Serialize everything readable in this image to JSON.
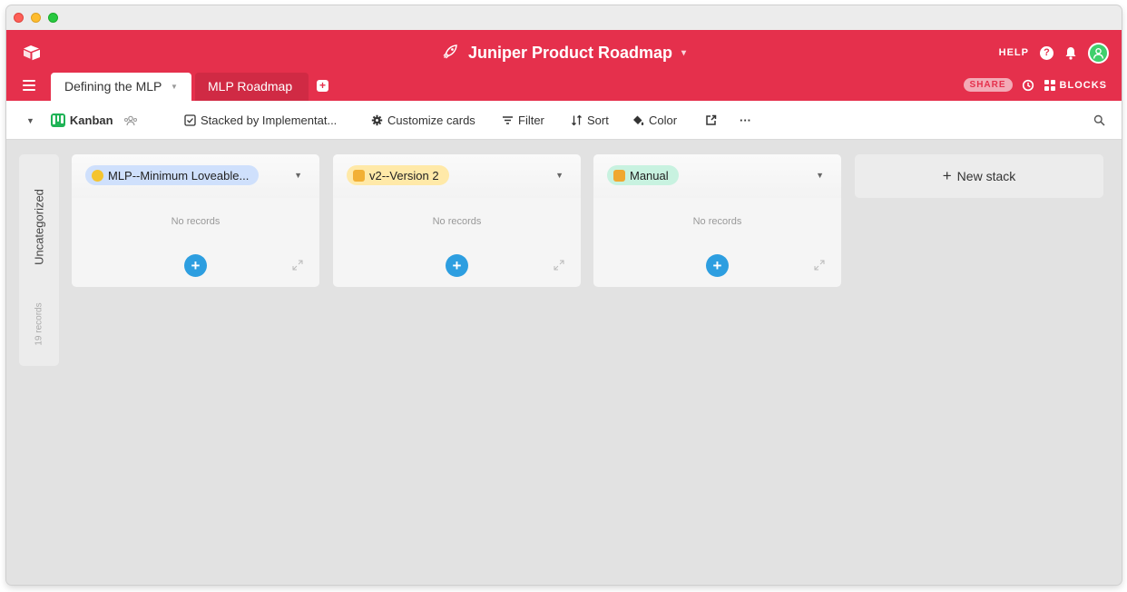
{
  "window": {
    "traffic_lights": [
      "close",
      "minimize",
      "zoom"
    ]
  },
  "header": {
    "base_title": "Juniper Product Roadmap",
    "help_label": "HELP",
    "help_icon": "?",
    "share_label": "SHARE",
    "blocks_label": "BLOCKS",
    "brand_color": "#e5304c"
  },
  "tabs": [
    {
      "label": "Defining the MLP",
      "active": true
    },
    {
      "label": "MLP Roadmap",
      "active": false
    }
  ],
  "add_tab_icon": "+",
  "viewbar": {
    "view_name": "Kanban",
    "stacked_by": "Stacked by Implementat...",
    "customize": "Customize cards",
    "filter": "Filter",
    "sort": "Sort",
    "color": "Color",
    "more": "···"
  },
  "board": {
    "uncategorized": {
      "title": "Uncategorized",
      "count": "19 records"
    },
    "stacks": [
      {
        "label": "MLP--Minimum Loveable...",
        "empty_text": "No records",
        "pill_color": "#cfe0fc",
        "icon": "yellow-heart-icon"
      },
      {
        "label": "v2--Version 2",
        "empty_text": "No records",
        "pill_color": "#ffe9a8",
        "icon": "victory-hand-icon"
      },
      {
        "label": "Manual",
        "empty_text": "No records",
        "pill_color": "#c8f2e0",
        "icon": "flexed-biceps-icon"
      }
    ],
    "new_stack_label": "New stack",
    "add_button_icon": "+"
  }
}
